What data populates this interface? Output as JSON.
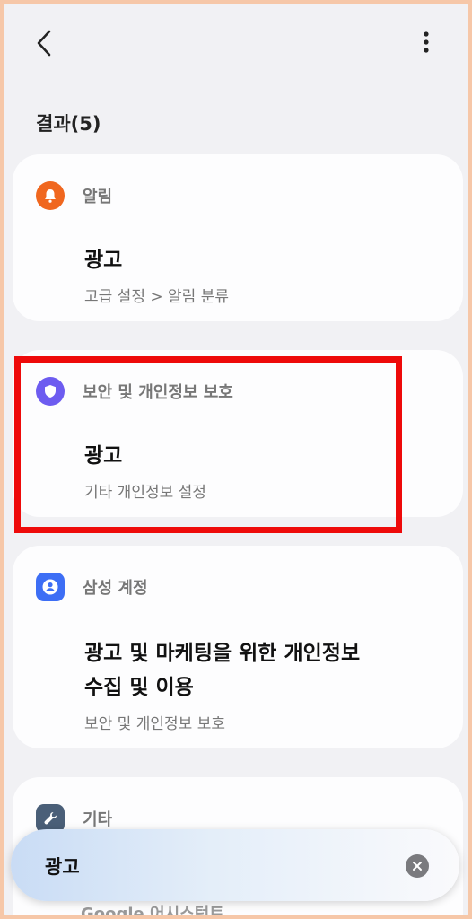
{
  "header": {
    "back_icon": "chevron-left-icon",
    "more_icon": "more-vertical-icon",
    "results_label": "결과(5)"
  },
  "results": [
    {
      "category": "알림",
      "icon": "bell-icon",
      "icon_color": "#f0671f",
      "title": "광고",
      "path": "고급 설정 > 알림 분류"
    },
    {
      "category": "보안 및 개인정보 보호",
      "icon": "shield-icon",
      "icon_color": "#6d5cf0",
      "title": "광고",
      "path": "기타 개인정보 설정"
    },
    {
      "category": "삼성 계정",
      "icon": "account-icon",
      "icon_color": "#3d6ef5",
      "title_line1": "광고 및 마케팅을 위한 개인정보",
      "title_line2": "수집 및 이용",
      "path": "보안 및 개인정보 보호"
    },
    {
      "category": "기타",
      "icon": "wrench-icon",
      "icon_color": "#4a5f78",
      "peek_title": "Google 어시스턴트"
    }
  ],
  "highlight_color": "#ee0a0a",
  "search": {
    "query": "광고",
    "clear_icon": "clear-circle-icon"
  }
}
